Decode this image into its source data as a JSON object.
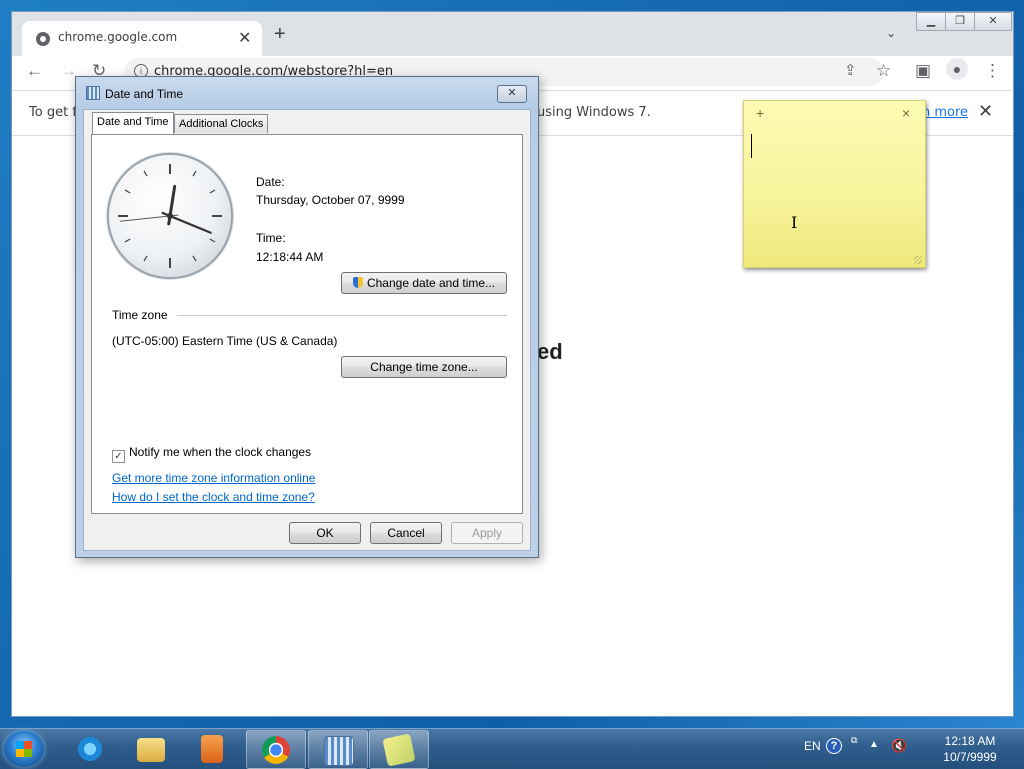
{
  "chrome": {
    "tab_title": "chrome.google.com",
    "url": "chrome.google.com/webstore?hl=en",
    "infobar_left": "To get fu",
    "infobar_right": "using Windows 7.",
    "infobar_link": "n more",
    "page_heading_fragment": "ed"
  },
  "dialog": {
    "title": "Date and Time",
    "tabs": [
      "Date and Time",
      "Additional Clocks"
    ],
    "date_label": "Date:",
    "date_value": "Thursday, October 07, 9999",
    "time_label": "Time:",
    "time_value": "12:18:44 AM",
    "change_datetime_button": "Change date and time...",
    "timezone_heading": "Time zone",
    "timezone_value": "(UTC-05:00) Eastern Time (US & Canada)",
    "change_timezone_button": "Change time zone...",
    "notify_label": "Notify me when the clock changes",
    "notify_checked": true,
    "link_more_info": "Get more time zone information online",
    "link_how_to": "How do I set the clock and time zone?",
    "ok": "OK",
    "cancel": "Cancel",
    "apply": "Apply",
    "clock_time": {
      "hour": 12,
      "minute": 18,
      "second": 44
    }
  },
  "sticky": {
    "add_glyph": "+",
    "close_glyph": "×"
  },
  "taskbar": {
    "language": "EN",
    "time": "12:18 AM",
    "date": "10/7/9999",
    "pinned": [
      "internet-explorer",
      "windows-explorer",
      "media-player",
      "chrome",
      "date-time-control-panel",
      "sticky-notes"
    ]
  }
}
